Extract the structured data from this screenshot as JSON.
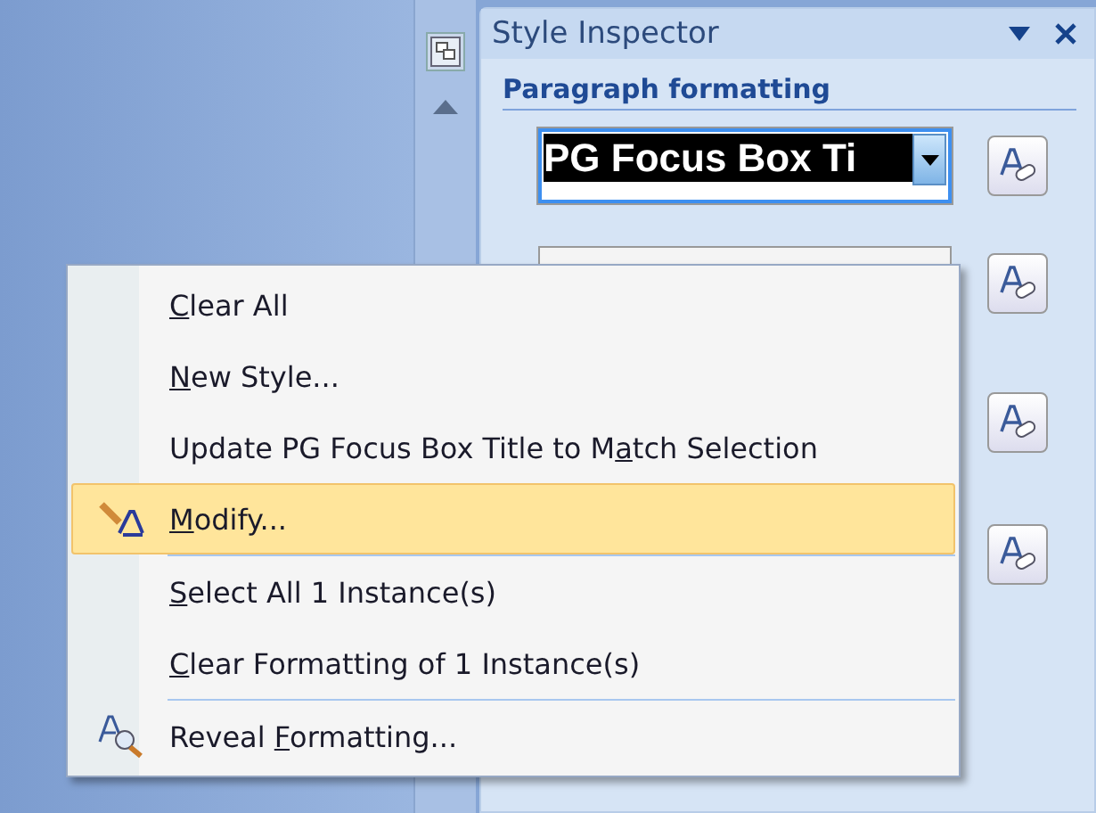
{
  "pane": {
    "title": "Style Inspector",
    "section": "Paragraph formatting",
    "style_box": {
      "value": "PG Focus Box Ti"
    }
  },
  "menu": {
    "groups": [
      [
        {
          "key": "C",
          "post": "lear All",
          "selected": false,
          "kind": "plain"
        },
        {
          "key": "N",
          "post": "ew Style...",
          "selected": false,
          "kind": "plain"
        },
        {
          "pre": "Update PG Focus Box Title to M",
          "key": "a",
          "post": "tch Selection",
          "selected": false,
          "kind": "plain"
        },
        {
          "key": "M",
          "post": "odify...",
          "selected": true,
          "kind": "modify"
        }
      ],
      [
        {
          "key": "S",
          "post": "elect All 1 Instance(s)",
          "selected": false,
          "kind": "plain"
        },
        {
          "key": "C",
          "post": "lear Formatting of 1 Instance(s)",
          "selected": false,
          "kind": "plain"
        }
      ],
      [
        {
          "pre": "Reveal ",
          "key": "F",
          "post": "ormatting...",
          "selected": false,
          "kind": "reveal"
        }
      ]
    ]
  }
}
